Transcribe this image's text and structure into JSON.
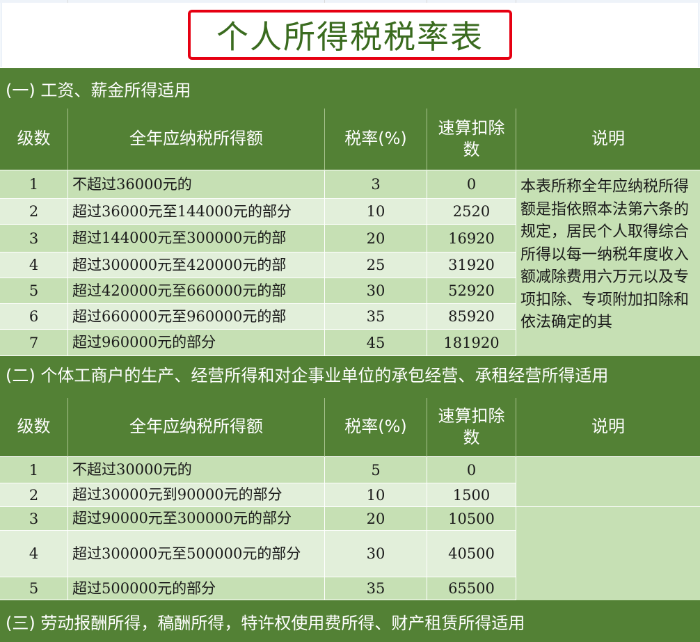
{
  "title": "个人所得税税率表",
  "section1": {
    "heading": "(一) 工资、薪金所得适用",
    "headers": [
      "级数",
      "全年应纳税所得额",
      "税率(%)",
      "速算扣除数",
      "说明"
    ],
    "rows": [
      [
        "1",
        "不超过36000元的",
        "3",
        "0"
      ],
      [
        "2",
        "超过36000元至144000元的部分",
        "10",
        "2520"
      ],
      [
        "3",
        "超过144000元至300000元的部",
        "20",
        "16920"
      ],
      [
        "4",
        "超过300000元至420000元的部",
        "25",
        "31920"
      ],
      [
        "5",
        "超过420000元至660000元的部",
        "30",
        "52920"
      ],
      [
        "6",
        "超过660000元至960000元的部",
        "35",
        "85920"
      ],
      [
        "7",
        "超过960000元的部分",
        "45",
        "181920"
      ]
    ],
    "note": "本表所称全年应纳税所得额是指依照本法第六条的规定，居民个人取得综合所得以每一纳税年度收入额减除费用六万元以及专项扣除、专项附加扣除和依法确定的其"
  },
  "section2": {
    "heading": "(二) 个体工商户的生产、经营所得和对企事业单位的承包经营、承租经营所得适用",
    "headers": [
      "级数",
      "全年应纳税所得额",
      "税率(%)",
      "速算扣除数",
      "说明"
    ],
    "rows": [
      [
        "1",
        "不超过30000元的",
        "5",
        "0"
      ],
      [
        "2",
        "超过30000元到90000元的部分",
        "10",
        "1500"
      ],
      [
        "3",
        "超过90000元至300000元的部分",
        "20",
        "10500"
      ],
      [
        "4",
        "超过300000元至500000元的部分",
        "30",
        "40500"
      ],
      [
        "5",
        "超过500000元的部分",
        "35",
        "65500"
      ]
    ]
  },
  "section3": {
    "heading": "(三) 劳动报酬所得，稿酬所得，特许权使用费所得、财产租赁所得适用"
  }
}
